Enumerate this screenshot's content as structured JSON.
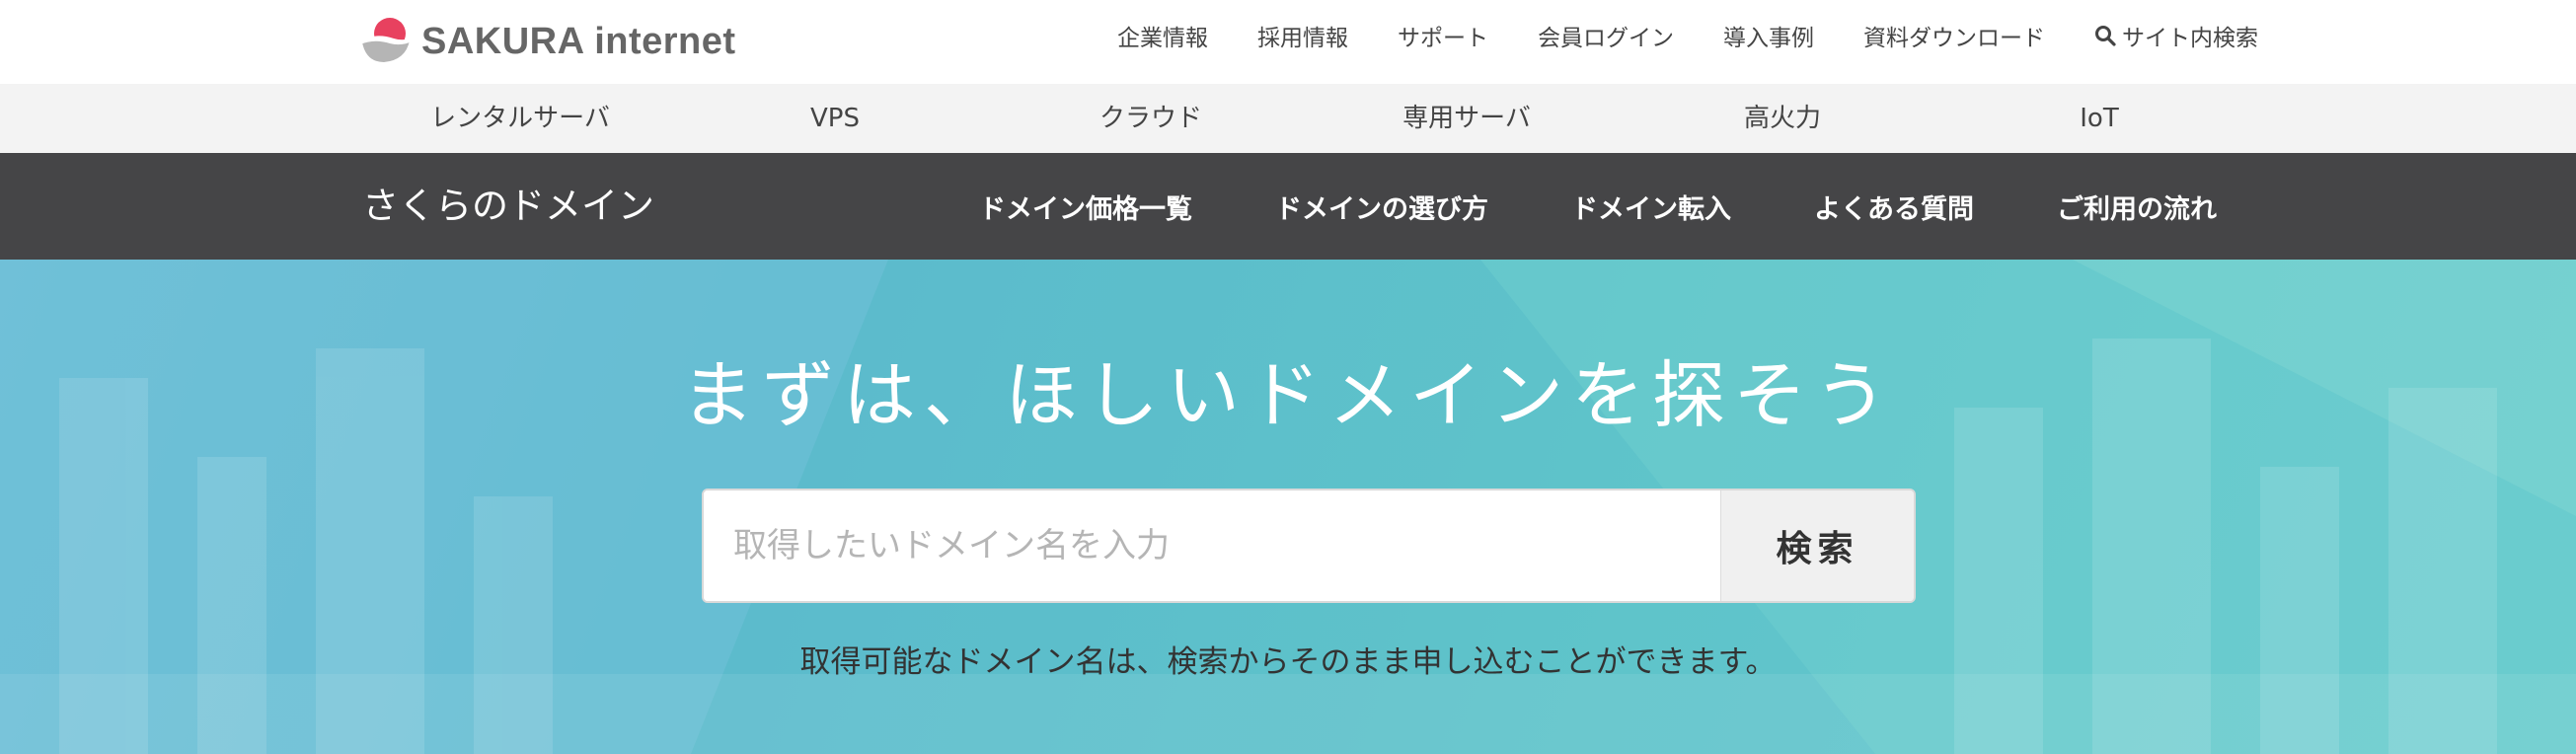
{
  "brand": {
    "logo_text": "SAKURA internet",
    "colors": {
      "mark_pink": "#e8415f",
      "mark_gray": "#b5b5b5",
      "text": "#666666"
    }
  },
  "utility_nav": [
    {
      "label": "企業情報"
    },
    {
      "label": "採用情報"
    },
    {
      "label": "サポート"
    },
    {
      "label": "会員ログイン"
    },
    {
      "label": "導入事例"
    },
    {
      "label": "資料ダウンロード"
    },
    {
      "label": "サイト内検索",
      "icon": "search-icon"
    }
  ],
  "service_nav": [
    {
      "label": "レンタルサーバ"
    },
    {
      "label": "VPS"
    },
    {
      "label": "クラウド"
    },
    {
      "label": "専用サーバ"
    },
    {
      "label": "高火力"
    },
    {
      "label": "IoT"
    }
  ],
  "domain_nav": {
    "title": "さくらのドメイン",
    "links": [
      {
        "label": "ドメイン価格一覧"
      },
      {
        "label": "ドメインの選び方"
      },
      {
        "label": "ドメイン転入"
      },
      {
        "label": "よくある質問"
      },
      {
        "label": "ご利用の流れ"
      }
    ],
    "background": "#454547"
  },
  "hero": {
    "headline": "まずは、ほしいドメインを探そう",
    "search": {
      "placeholder": "取得したいドメイン名を入力",
      "value": "",
      "button_label": "検索"
    },
    "note": "取得可能なドメイン名は、検索からそのまま申し込むことができます。"
  }
}
